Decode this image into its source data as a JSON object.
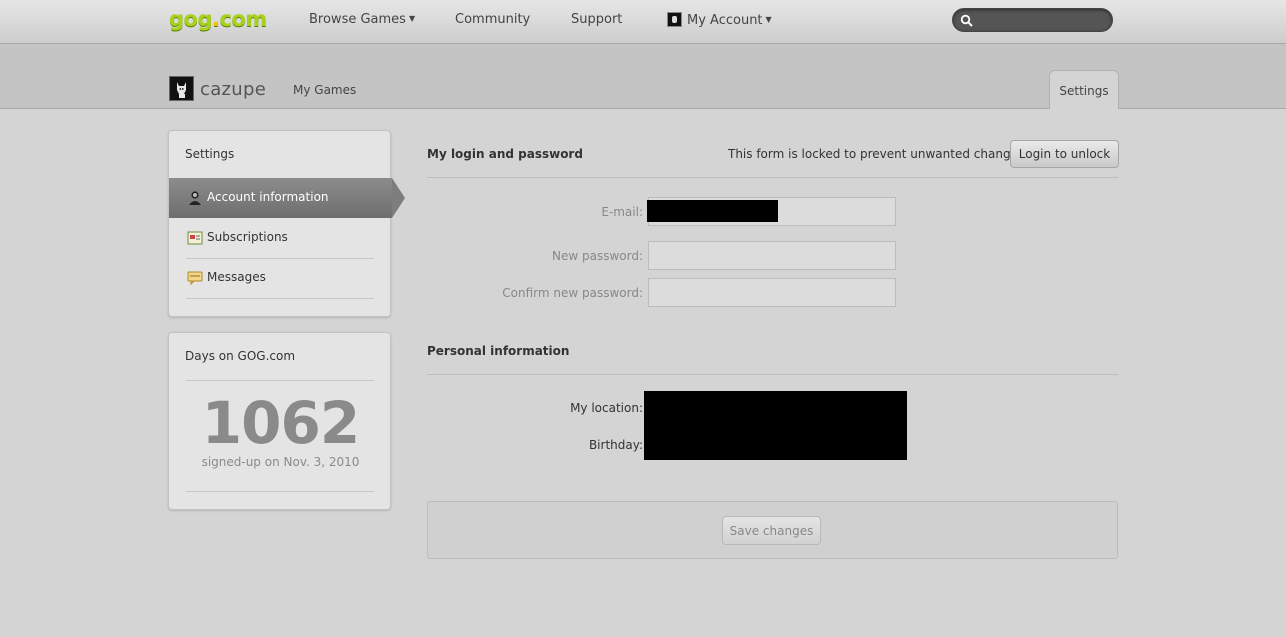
{
  "nav": {
    "logo_main": "gog",
    "logo_dot": ".",
    "logo_tld": "com",
    "browse_games": "Browse Games",
    "community": "Community",
    "support": "Support",
    "my_account": "My Account",
    "search_placeholder": ""
  },
  "header": {
    "username": "cazupe",
    "my_games": "My Games",
    "settings_tab": "Settings"
  },
  "sidebar": {
    "title": "Settings",
    "items": [
      {
        "label": "Account information",
        "icon": "account-icon",
        "active": true
      },
      {
        "label": "Subscriptions",
        "icon": "subscriptions-icon",
        "active": false
      },
      {
        "label": "Messages",
        "icon": "messages-icon",
        "active": false
      }
    ]
  },
  "days": {
    "title": "Days on GOG.com",
    "count": "1062",
    "signup": "signed-up on Nov. 3, 2010"
  },
  "login": {
    "title": "My login and password",
    "lock_message": "This form is locked to prevent unwanted changes.",
    "unlock_label": "Login to unlock",
    "email_label": "E-mail:",
    "new_password_label": "New password:",
    "confirm_password_label": "Confirm new password:"
  },
  "personal": {
    "title": "Personal information",
    "location_label": "My location:",
    "birthday_label": "Birthday:"
  },
  "actions": {
    "save_label": "Save changes"
  },
  "colors": {
    "logo_green": "#a7d11a",
    "logo_dot": "#f2c200",
    "active_item": "#7d7d7d"
  }
}
